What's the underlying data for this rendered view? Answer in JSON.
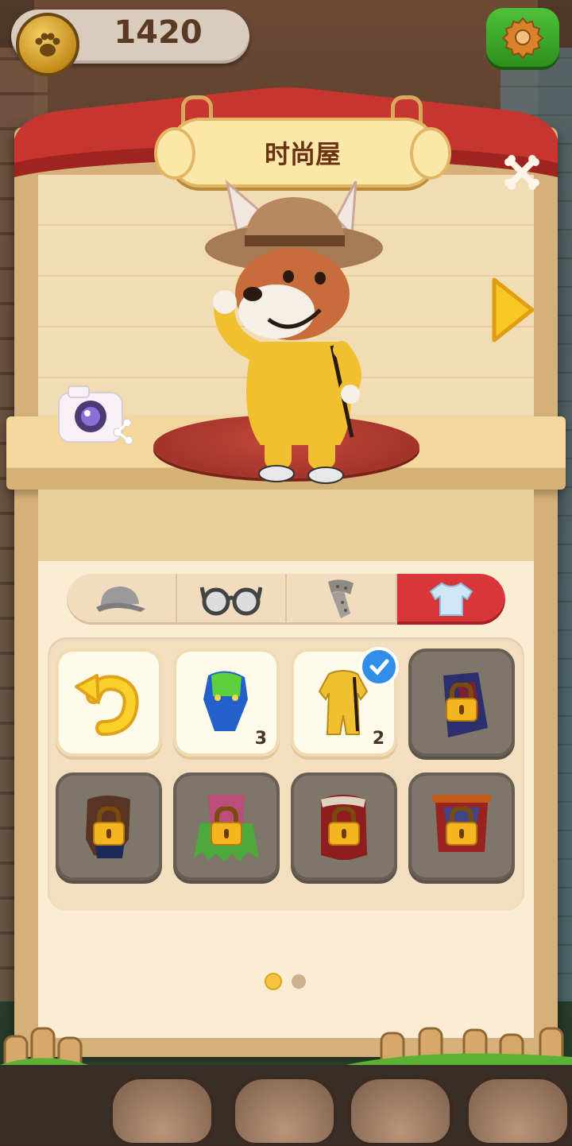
{
  "coins": {
    "value": "1420",
    "icon": "paw-coin-icon"
  },
  "settings": {
    "icon": "gear-icon"
  },
  "panel": {
    "title": "时尚屋",
    "close_icon": "crossed-bones-close-icon",
    "next_icon": "right-arrow-icon",
    "camera_icon": "camera-share-icon"
  },
  "tabs": [
    {
      "icon": "cap-icon",
      "active": false
    },
    {
      "icon": "glasses-icon",
      "active": false
    },
    {
      "icon": "scarf-icon",
      "active": false
    },
    {
      "icon": "tshirt-icon",
      "active": true
    }
  ],
  "items": [
    {
      "name": "reset",
      "icon": "undo-arrow-icon",
      "locked": false,
      "count": ""
    },
    {
      "name": "blue-overalls",
      "icon": "blue-overalls-icon",
      "locked": false,
      "count": "3"
    },
    {
      "name": "yellow-jumpsuit",
      "icon": "yellow-jumpsuit-icon",
      "locked": false,
      "count": "2",
      "selected": true
    },
    {
      "name": "dark-costume",
      "icon": "dark-costume-icon",
      "locked": true,
      "count": ""
    },
    {
      "name": "brown-outfit",
      "icon": "brown-outfit-icon",
      "locked": true,
      "count": ""
    },
    {
      "name": "grass-skirt",
      "icon": "grass-skirt-icon",
      "locked": true,
      "count": ""
    },
    {
      "name": "red-coat",
      "icon": "red-coat-icon",
      "locked": true,
      "count": ""
    },
    {
      "name": "red-jacket",
      "icon": "red-jacket-icon",
      "locked": true,
      "count": ""
    }
  ],
  "pagination": {
    "current": 1,
    "total": 2
  },
  "colors": {
    "accent_red": "#d9363a",
    "gold": "#f3c43a",
    "check_blue": "#2f8fe6"
  }
}
